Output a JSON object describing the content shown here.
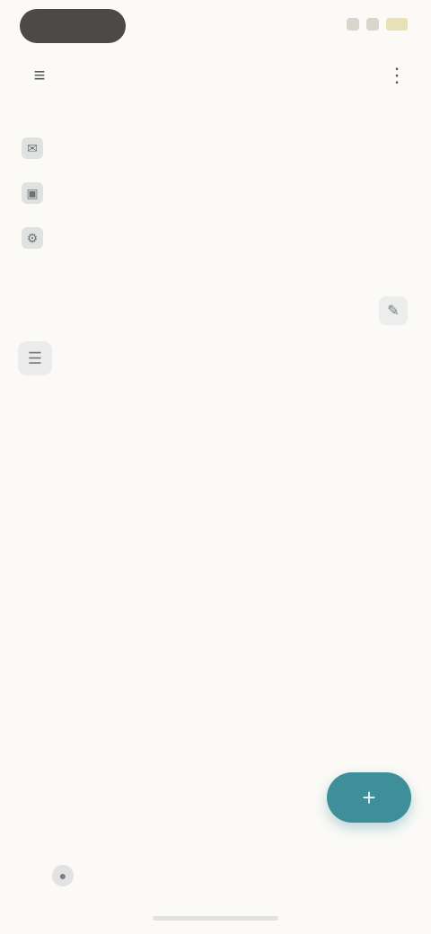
{
  "topbar": {
    "menu_icon": "menu-icon",
    "title": "",
    "more_icon": "more-vertical-icon"
  },
  "quick_actions": [
    {
      "icon": "chat-icon",
      "label": ""
    },
    {
      "icon": "image-icon",
      "label": ""
    },
    {
      "icon": "settings-icon",
      "label": ""
    }
  ],
  "section": {
    "title": "",
    "action_icon": "edit-icon"
  },
  "filters": {
    "icon": "filter-icon",
    "chips": [
      "",
      "",
      ""
    ]
  },
  "list": [
    {
      "title": "",
      "subtitle": ""
    }
  ],
  "fab": {
    "icon": "plus-icon"
  },
  "bottom": {
    "icon": "person-icon",
    "label": ""
  },
  "colors": {
    "accent": "#3f8f9a",
    "background": "#fbfaf7"
  }
}
